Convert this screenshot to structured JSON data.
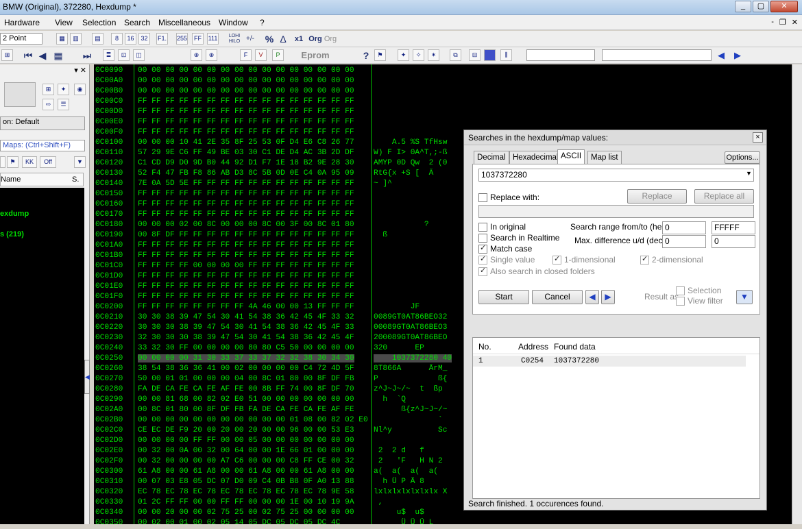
{
  "window": {
    "title": "BMW (Original), 372280, Hexdump *",
    "min": "_",
    "max": "▢",
    "close": "✕"
  },
  "menu": [
    "Hardware",
    "View",
    "Selection",
    "Search",
    "Miscellaneous",
    "Window",
    "?"
  ],
  "mdi": {
    "min": "-",
    "restore": "❐",
    "close": "✕"
  },
  "toolbar1": {
    "font_size": "2 Point",
    "b1": "8",
    "b2": "16",
    "b3": "32",
    "b4": "F1.",
    "b5": "255",
    "b6": "FF",
    "b7": "111",
    "b8": "LOHI HILO",
    "b9": "+/-",
    "b10": "%",
    "b11": "Δ",
    "b12": "x1",
    "b13": "Org",
    "b14": "Org"
  },
  "toolbar2": {
    "eprom": "Eprom",
    "icons": [
      "⏮",
      "◀",
      "▦",
      "⏭"
    ]
  },
  "left": {
    "project": "on: Default",
    "maps": "Maps: (Ctrl+Shift+F)",
    "kk": "KK",
    "off": "Off",
    "col_name": "Name",
    "col_s": "S.",
    "hexdump": "exdump",
    "maps_count": "s (219)"
  },
  "hex": {
    "rows": [
      {
        "a": "0C0090",
        "b": "00 00 00 00 00 00 00 00 00 00 00 00 00 00 00 00",
        "t": ""
      },
      {
        "a": "0C00A0",
        "b": "00 00 00 00 00 00 00 00 00 00 00 00 00 00 00 00",
        "t": ""
      },
      {
        "a": "0C00B0",
        "b": "00 00 00 00 00 00 00 00 00 00 00 00 00 00 00 00",
        "t": ""
      },
      {
        "a": "0C00C0",
        "b": "FF FF FF FF FF FF FF FF FF FF FF FF FF FF FF FF",
        "t": ""
      },
      {
        "a": "0C00D0",
        "b": "FF FF FF FF FF FF FF FF FF FF FF FF FF FF FF FF",
        "t": ""
      },
      {
        "a": "0C00E0",
        "b": "FF FF FF FF FF FF FF FF FF FF FF FF FF FF FF FF",
        "t": ""
      },
      {
        "a": "0C00F0",
        "b": "FF FF FF FF FF FF FF FF FF FF FF FF FF FF FF FF",
        "t": ""
      },
      {
        "a": "0C0100",
        "b": "00 00 00 10 41 2E 35 8F 25 53 0F D4 E6 C8 26 77",
        "t": "    A.5 %S TfHsw"
      },
      {
        "a": "0C0110",
        "b": "57 29 9E C6 FF 49 BE 03 30 C1 DE D4 AC 3B 2D DF",
        "t": "W) F I> 0A^T,;-ß"
      },
      {
        "a": "0C0120",
        "b": "C1 CD D9 D0 9D B0 44 92 D1 F7 1E 18 B2 9E 28 30",
        "t": "AMYP 0D Qw  2 (0"
      },
      {
        "a": "0C0130",
        "b": "52 F4 47 FB F8 86 AB D3 8C 5B 0D 0E C4 0A 95 09",
        "t": "RtG{x +S [  Ä"
      },
      {
        "a": "0C0140",
        "b": "7E 0A 5D 5E FF FF FF FF FF FF FF FF FF FF FF FF",
        "t": "~ ]^"
      },
      {
        "a": "0C0150",
        "b": "FF FF FF FF FF FF FF FF FF FF FF FF FF FF FF FF",
        "t": ""
      },
      {
        "a": "0C0160",
        "b": "FF FF FF FF FF FF FF FF FF FF FF FF FF FF FF FF",
        "t": ""
      },
      {
        "a": "0C0170",
        "b": "FF FF FF FF FF FF FF FF FF FF FF FF FF FF FF FF",
        "t": ""
      },
      {
        "a": "0C0180",
        "b": "00 00 00 02 00 8C 00 00 00 8C 00 3F 00 8C 01 80",
        "t": "           ?"
      },
      {
        "a": "0C0190",
        "b": "00 8F DF FF FF FF FF FF FF FF FF FF FF FF FF FF",
        "t": "  ß"
      },
      {
        "a": "0C01A0",
        "b": "FF FF FF FF FF FF FF FF FF FF FF FF FF FF FF FF",
        "t": ""
      },
      {
        "a": "0C01B0",
        "b": "FF FF FF FF FF FF FF FF FF FF FF FF FF FF FF FF",
        "t": ""
      },
      {
        "a": "0C01C0",
        "b": "FF FF FF FF 00 00 00 00 FF FF FF FF FF FF FF FF",
        "t": ""
      },
      {
        "a": "0C01D0",
        "b": "FF FF FF FF FF FF FF FF FF FF FF FF FF FF FF FF",
        "t": ""
      },
      {
        "a": "0C01E0",
        "b": "FF FF FF FF FF FF FF FF FF FF FF FF FF FF FF FF",
        "t": ""
      },
      {
        "a": "0C01F0",
        "b": "FF FF FF FF FF FF FF FF FF FF FF FF FF FF FF FF",
        "t": ""
      },
      {
        "a": "0C0200",
        "b": "FF FF FF FF FF FF FF FF 4A 46 00 00 13 FF FF FF",
        "t": "        JF"
      },
      {
        "a": "0C0210",
        "b": "30 30 38 39 47 54 30 41 54 38 36 42 45 4F 33 32",
        "t": "0089GT0AT86BEO32"
      },
      {
        "a": "0C0220",
        "b": "30 30 30 38 39 47 54 30 41 54 38 36 42 45 4F 33",
        "t": "00089GT0AT86BEO3"
      },
      {
        "a": "0C0230",
        "b": "32 30 30 30 38 39 47 54 30 41 54 38 36 42 45 4F",
        "t": "200089GT0AT86BEO"
      },
      {
        "a": "0C0240",
        "b": "33 32 30 FF 00 00 00 00 80 80 C5 50 00 00 00 00",
        "t": "320      EP"
      },
      {
        "a": "0C0250",
        "b": "00 00 00 00 31 30 33 37 33 37 32 32 38 30 34 30",
        "t": "    1037372280 40"
      },
      {
        "a": "0C0260",
        "b": "38 54 38 36 36 41 00 02 00 00 00 00 C4 72 4D 5F",
        "t": "8T866A      ÄrM_"
      },
      {
        "a": "0C0270",
        "b": "50 00 01 01 00 00 00 04 00 8C 01 80 00 8F DF FB",
        "t": "P             ß{"
      },
      {
        "a": "0C0280",
        "b": "FA DE CA FE CA FE AF FE 00 8B FF 74 00 8F DF 70",
        "t": "z^J~J~/~  t  ßp"
      },
      {
        "a": "0C0290",
        "b": "00 00 81 68 00 82 02 E0 51 00 00 00 00 00 00 00",
        "t": "  h  `Q"
      },
      {
        "a": "0C02A0",
        "b": "00 8C 01 80 00 8F DF FB FA DE CA FE CA FE AF FE",
        "t": "      ß{z^J~J~/~"
      },
      {
        "a": "0C02B0",
        "b": "00 00 00 00 00 00 00 00 00 00 00 01 08 00 82 02 E0",
        "t": "              `"
      },
      {
        "a": "0C02C0",
        "b": "CE EC DE F9 20 00 20 00 20 00 00 96 00 00 53 E3",
        "t": "Nl^y          Sc"
      },
      {
        "a": "0C02D0",
        "b": "00 00 00 00 FF FF 00 00 05 00 00 00 00 00 00 00",
        "t": ""
      },
      {
        "a": "0C02E0",
        "b": "00 32 00 0A 00 32 00 64 00 00 1E 66 01 00 00 00",
        "t": " 2  2 d   f"
      },
      {
        "a": "0C02F0",
        "b": "00 32 00 00 00 00 A7 C6 00 00 00 C8 FF CE 00 32",
        "t": " 2   'F   H N 2"
      },
      {
        "a": "0C0300",
        "b": "61 A8 00 00 61 A8 00 00 61 A8 00 00 61 A8 00 00",
        "t": "a(  a(  a(  a("
      },
      {
        "a": "0C0310",
        "b": "00 07 03 E8 05 DC 07 D0 09 C4 0B B8 0F A0 13 88",
        "t": "  h Ü P Ä 8"
      },
      {
        "a": "0C0320",
        "b": "EC 78 EC 78 EC 78 EC 78 EC 78 EC 78 EC 78 9E 58",
        "t": "lxlxlxlxlxlxlx X"
      },
      {
        "a": "0C0330",
        "b": "01 2C FF FF 00 00 FF FF 00 00 00 1E 00 10 19 9A",
        "t": " ,"
      },
      {
        "a": "0C0340",
        "b": "00 00 20 00 00 02 75 25 00 02 75 25 00 00 00 00",
        "t": "     u$  u$"
      },
      {
        "a": "0C0350",
        "b": "00 02 00 01 00 02 05 14 05 DC 05 DC 05 DC 4C",
        "t": "      Ü Ü Ü L"
      }
    ]
  },
  "dialog": {
    "title": "Searches in the hexdump/map values:",
    "close": "×",
    "tabs": [
      "Decimal",
      "Hexadecimal",
      "ASCII",
      "Map list"
    ],
    "active_tab": "ASCII",
    "options": "Options...",
    "search_value": "1037372280",
    "replace_with": "Replace with:",
    "replace": "Replace",
    "replace_all": "Replace all",
    "in_original": "In original",
    "search_realtime": "Search in Realtime",
    "match_case": "Match case",
    "single_value": "Single value",
    "one_dim": "1-dimensional",
    "two_dim": "2-dimensional",
    "closed_folders": "Also search in closed folders",
    "range_label": "Search range from/to (hex)",
    "range_from": "0",
    "range_to": "FFFFF",
    "maxdiff_label": "Max. difference u/d (dec)",
    "maxdiff_u": "0",
    "maxdiff_d": "0",
    "start": "Start",
    "cancel": "Cancel",
    "result_as": "Result as",
    "selection": "Selection",
    "view_filter": "View filter",
    "col_no": "No.",
    "col_address": "Address",
    "col_found": "Found data",
    "results": [
      {
        "no": "1",
        "address": "C0254",
        "data": "1037372280"
      }
    ],
    "status": "Search finished. 1 occurences found."
  }
}
